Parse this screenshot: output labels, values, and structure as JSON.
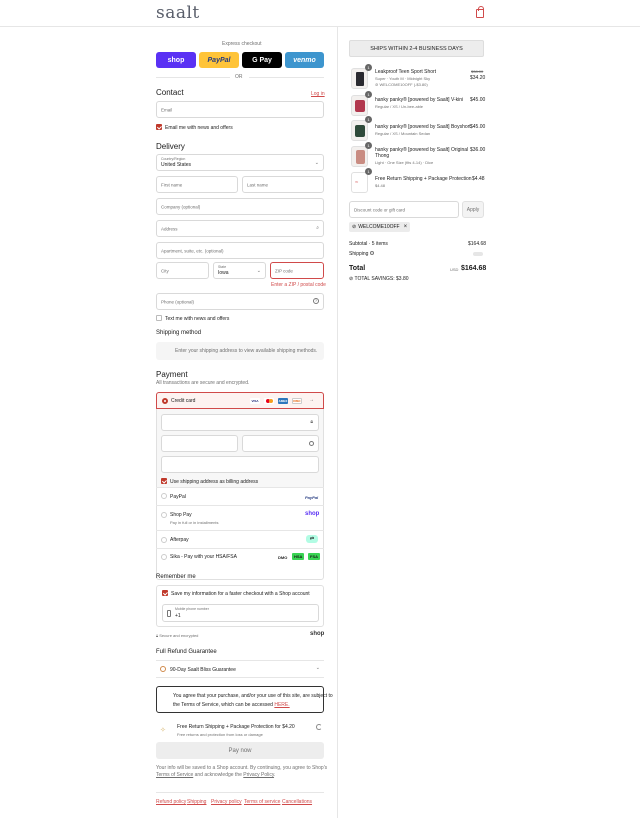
{
  "brand": {
    "logo": "saalt"
  },
  "express": {
    "label": "Express checkout",
    "buttons": {
      "shop": "shop",
      "paypal": "PayPal",
      "gpay": "G Pay",
      "venmo": "venmo"
    },
    "or": "OR"
  },
  "contact": {
    "title": "Contact",
    "login": "Log in",
    "email_placeholder": "Email",
    "email_news": "Email me with news and offers"
  },
  "delivery": {
    "title": "Delivery",
    "country_label": "Country/Region",
    "country_value": "United States",
    "first_name": "First name",
    "last_name": "Last name",
    "company": "Company (optional)",
    "address": "Address",
    "apartment": "Apartment, suite, etc. (optional)",
    "city": "City",
    "state_label": "State",
    "state_value": "Iowa",
    "zip": "ZIP code",
    "zip_error": "Enter a ZIP / postal code",
    "phone": "Phone (optional)",
    "text_news": "Text me with news and offers"
  },
  "shipping_method": {
    "title": "Shipping method",
    "placeholder": "Enter your shipping address to view available shipping methods."
  },
  "payment": {
    "title": "Payment",
    "subtitle": "All transactions are secure and encrypted.",
    "credit_card": "Credit card",
    "card_icons": [
      "VISA",
      "MC",
      "AMEX",
      "DISC"
    ],
    "billing_same": "Use shipping address as billing address",
    "paypal": "PayPal",
    "paypal_logo": "PayPal",
    "shop_pay": "Shop Pay",
    "shop_pay_sub": "Pay in full or in installments",
    "shop_logo": "shop",
    "afterpay": "Afterpay",
    "sika": "Sika - Pay with your HSA/FSA",
    "sika_badges": [
      "DMO",
      "HSA",
      "FSA"
    ]
  },
  "remember": {
    "title": "Remember me",
    "save_info": "Save my information for a faster checkout with a Shop account",
    "mobile_label": "Mobile phone number",
    "mobile_value": "+1",
    "secure": "Secure and encrypted",
    "shop_logo": "shop"
  },
  "refund": {
    "title": "Full Refund Guarantee",
    "guarantee": "90-Day Saalt Bliss Guarantee"
  },
  "terms_box": {
    "line1": "You agree that your purchase, and/or your use of this site, are subject to",
    "line2": "the Terms of Service, which can be accessed",
    "link": "HERE."
  },
  "protection": {
    "title": "Free Return Shipping + Package Protection for $4.20",
    "sub": "Free returns and protection from loss or damage"
  },
  "pay_now": "Pay now",
  "disclaimer": {
    "line1": "Your info will be saved to a Shop account. By continuing, you agree to Shop's",
    "tos": "Terms of Service",
    "mid": " and acknowledge the ",
    "privacy": "Privacy Policy",
    "end": "."
  },
  "footer_links": [
    "Refund policy",
    "Shipping",
    "Privacy policy",
    "Terms of service",
    "Cancellations"
  ],
  "summary": {
    "banner": "SHIPS WITHIN 2-4 BUSINESS DAYS",
    "items": [
      {
        "qty": "1",
        "name": "Leakproof Teen Sport Short",
        "variant": "Super · Youth M · Midnight Sky",
        "discount": "WELCOME10OFF (-$3.80)",
        "old_price": "$38.00",
        "price": "$34.20"
      },
      {
        "qty": "1",
        "name": "hanky panky® [powered by Saalt] V-kini",
        "variant": "Regular / XS / Un-bee-able",
        "price": "$45.00"
      },
      {
        "qty": "1",
        "name": "hanky panky® [powered by Saalt] Boyshort",
        "variant": "Regular / XS / Mountain Sedan",
        "price": "$45.00"
      },
      {
        "qty": "1",
        "name": "hanky panky® [powered by Saalt] Original",
        "name2": "Thong",
        "variant": "Light · One Size (fits 4-14) · Dice",
        "price": "$36.00"
      },
      {
        "qty": "1",
        "name": "Free Return Shipping + Package Protection",
        "variant": "$4.48",
        "price": "$4.48"
      }
    ],
    "discount_placeholder": "Discount code or gift card",
    "apply": "Apply",
    "code_tag": "WELCOME10OFF",
    "subtotal_label": "Subtotal · 5 items",
    "subtotal_value": "$164.68",
    "shipping_label": "Shipping",
    "total_label": "Total",
    "currency": "USD",
    "total_value": "$164.68",
    "savings": "TOTAL SAVINGS: $3.80"
  },
  "colors": {
    "accent": "#c0392b",
    "shop": "#5a31f4",
    "paypal": "#ffc439",
    "venmo": "#3d95ce"
  }
}
